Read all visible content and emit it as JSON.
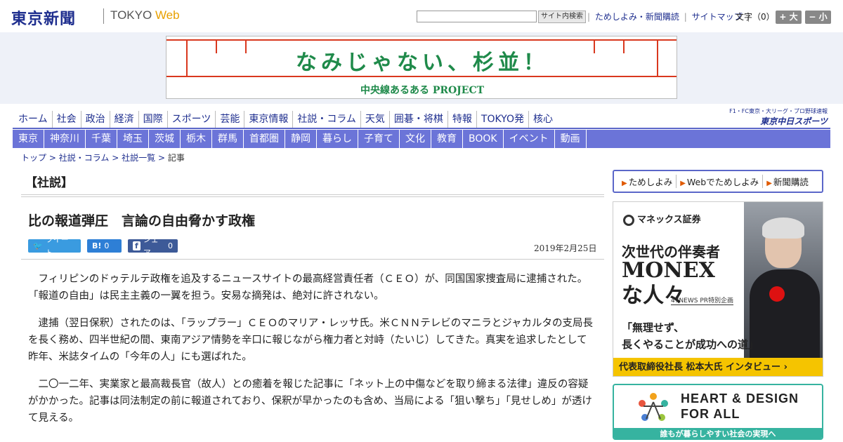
{
  "header": {
    "logo_main": "東京新聞",
    "logo_tokyo": "TOKYO",
    "logo_web": "Web",
    "search_placeholder": "",
    "search_button": "サイト内検索",
    "util_links": [
      "ためしよみ・新聞購読",
      "サイトマップ"
    ],
    "fontsize_label": "文字（0）",
    "fontsize_large": "+ 大",
    "fontsize_small": "− 小"
  },
  "banner": {
    "title": "なみじゃない、杉並！",
    "subtitle": "中央線あるある PROJECT"
  },
  "global_nav": [
    "ホーム",
    "社会",
    "政治",
    "経済",
    "国際",
    "スポーツ",
    "芸能",
    "東京情報",
    "社説・コラム",
    "天気",
    "囲碁・将棋",
    "特報",
    "TOKYO発",
    "核心"
  ],
  "chunichi": {
    "top": "F1・FC東京・大リーグ・プロ野球速報",
    "bottom": "東京中日スポーツ"
  },
  "local_nav": [
    "東京",
    "神奈川",
    "千葉",
    "埼玉",
    "茨城",
    "栃木",
    "群馬",
    "首都圏",
    "静岡",
    "暮らし",
    "子育て",
    "文化",
    "教育",
    "BOOK",
    "イベント",
    "動画"
  ],
  "breadcrumb": {
    "items": [
      "トップ",
      "社説・コラム",
      "社説一覧"
    ],
    "current": "記事",
    "sep": ">"
  },
  "article": {
    "section": "【社説】",
    "title": "比の報道弾圧　言論の自由脅かす政権",
    "share": {
      "tweet": "ツイート",
      "hatena_count": "0",
      "fb_label": "シェア",
      "fb_count": "0"
    },
    "date": "2019年2月25日",
    "paragraphs": [
      "フィリピンのドゥテルテ政権を追及するニュースサイトの最高経営責任者（ＣＥＯ）が、同国国家捜査局に逮捕された。「報道の自由」は民主主義の一翼を担う。安易な摘発は、絶対に許されない。",
      "逮捕（翌日保釈）されたのは、「ラップラー」ＣＥＯのマリア・レッサ氏。米ＣＮＮテレビのマニラとジャカルタの支局長を長く務め、四半世紀の間、東南アジア情勢を辛口に報じながら権力者と対峙（たいじ）してきた。真実を追求したとして昨年、米誌タイムの「今年の人」にも選ばれた。",
      "二〇一二年、実業家と最高裁長官（故人）との癒着を報じた記事に「ネット上の中傷などを取り締まる法律」違反の容疑がかかった。記事は同法制定の前に報道されており、保釈が早かったのも含め、当局による「狙い撃ち」「見せしめ」が透けて見える。"
    ]
  },
  "sidebar": {
    "links": [
      "ためしよみ",
      "Webでためしよみ",
      "新聞購読"
    ],
    "monex": {
      "logo": "マネックス証券",
      "headline1": "次世代の伴奏者",
      "headline2": "MONEXな人々",
      "tag": "47NEWS PR特別企画",
      "quote_line1": "「無理せず、",
      "quote_line2": "長くやることが成功への道」",
      "bar": "代表取締役社長  松本大氏 インタビュー ›"
    },
    "heart": {
      "title_line1": "HEART & DESIGN",
      "title_line2": "FOR ALL",
      "bar": "誰もが暮らしやすい社会の実現へ"
    }
  }
}
